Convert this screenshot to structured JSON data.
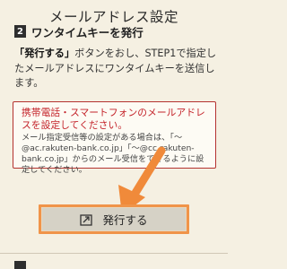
{
  "header": {
    "title": "メールアドレス設定"
  },
  "step": {
    "number": "2",
    "title": "ワンタイムキーを発行"
  },
  "instructions": {
    "button_ref": "「発行する」",
    "text": "ボタンをおし、STEP1で指定したメールアドレスにワンタイムキーを送信します。"
  },
  "notice": {
    "red_text": "携帯電話・スマートフォンのメールアドレスを設定してください。",
    "body_text": "メール指定受信等の設定がある場合は、「～@ac.rakuten-bank.co.jp」「～@cc.rakuten-bank.co.jp」からのメール受信をできるように設定してください。"
  },
  "issue_button": {
    "label": "発行する",
    "icon": "issue-document-icon"
  },
  "colors": {
    "background": "#f5f0e2",
    "notice_border": "#b4322f",
    "notice_red": "#c4232a",
    "arrow": "#f08a3a",
    "button_highlight": "#f09449"
  }
}
